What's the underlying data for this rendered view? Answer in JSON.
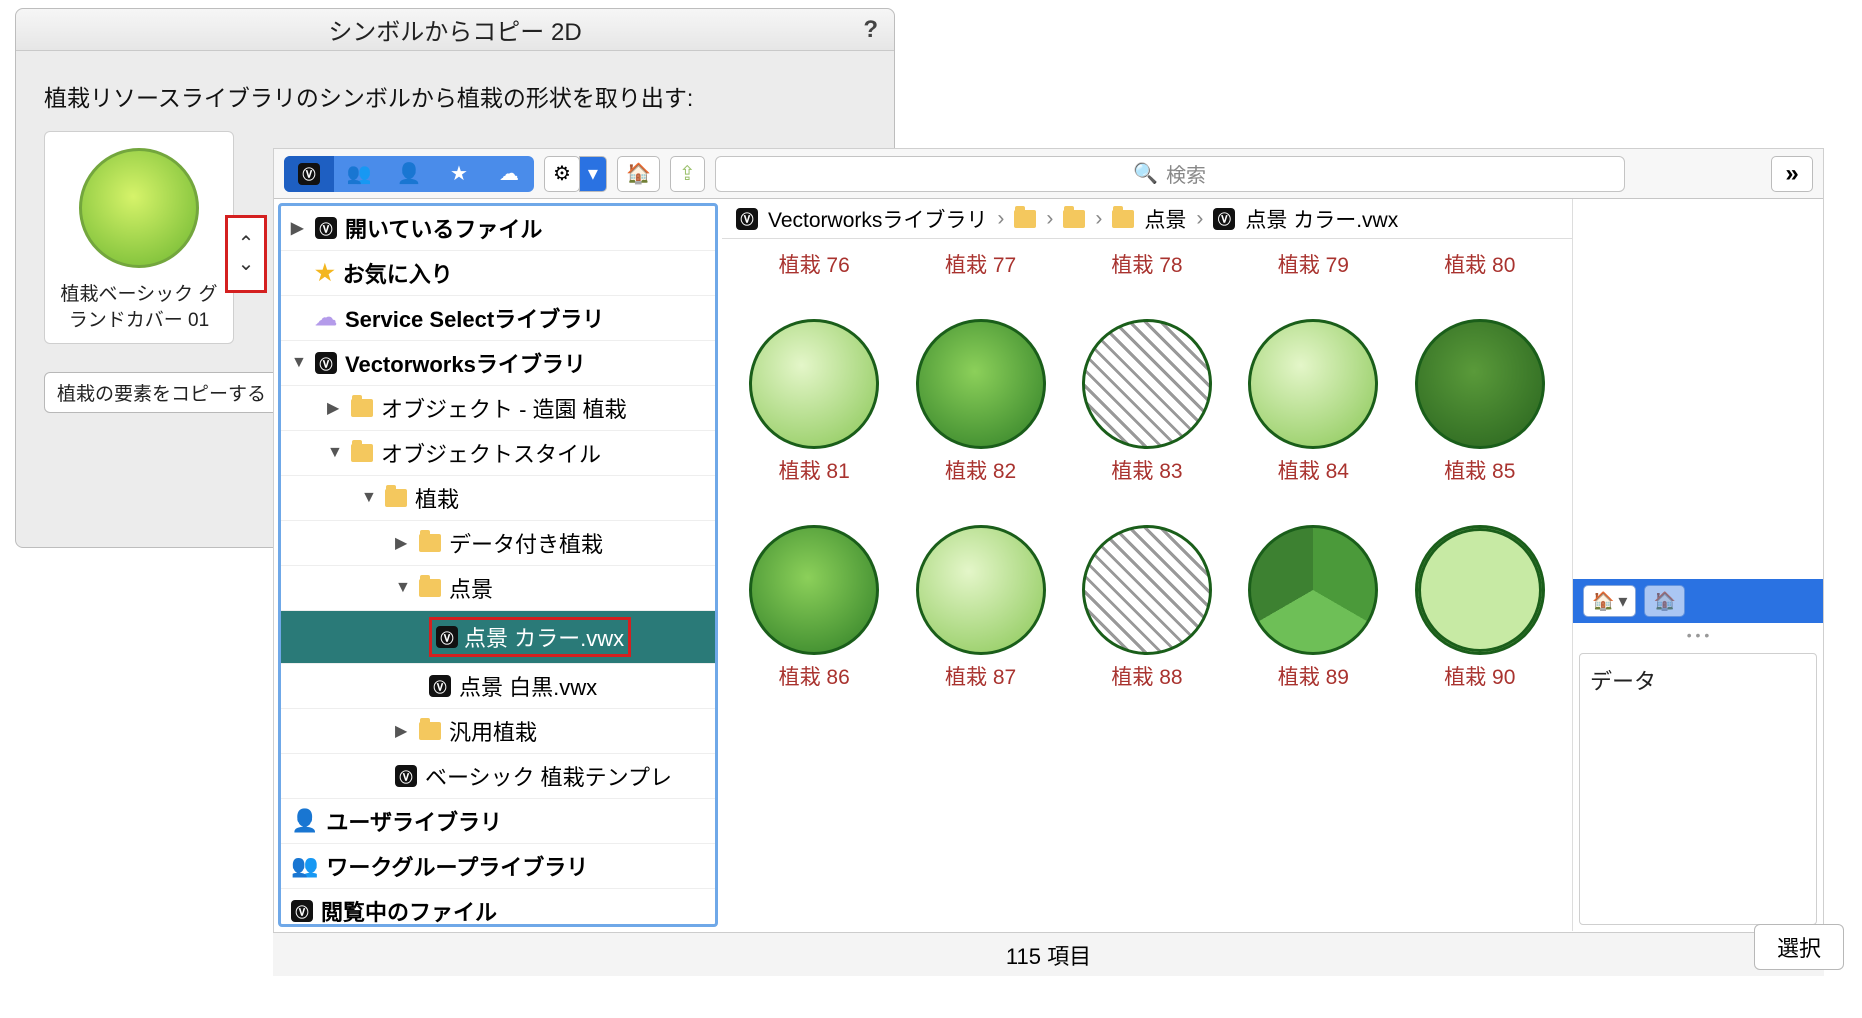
{
  "dialog": {
    "title": "シンボルからコピー 2D",
    "help": "?",
    "instruction": "植栽リソースライブラリのシンボルから植栽の形状を取り出す:",
    "preview_label": "植栽ベーシック グランドカバー 01",
    "copy_button": "植栽の要素をコピーする"
  },
  "toolbar": {
    "search_placeholder": "検索",
    "overflow": "»"
  },
  "tree": {
    "open_files": "開いているファイル",
    "favorites": "お気に入り",
    "service_select": "Service Selectライブラリ",
    "vw_lib": "Vectorworksライブラリ",
    "obj_landscape": "オブジェクト - 造園 植栽",
    "obj_styles": "オブジェクトスタイル",
    "plants": "植栽",
    "data_plants": "データ付き植栽",
    "scenery": "点景",
    "scenery_color": "点景 カラー.vwx",
    "scenery_bw": "点景 白黒.vwx",
    "general_plants": "汎用植栽",
    "basic_template": "ベーシック 植栽テンプレ",
    "user_lib": "ユーザライブラリ",
    "workgroup_lib": "ワークグループライブラリ",
    "browsing_file": "閲覧中のファイル"
  },
  "breadcrumb": {
    "root": "Vectorworksライブラリ",
    "scenery": "点景",
    "file": "点景 カラー.vwx"
  },
  "thumbs_row1": [
    "植栽 76",
    "植栽 77",
    "植栽 78",
    "植栽 79",
    "植栽 80"
  ],
  "thumbs_row2": [
    "植栽 81",
    "植栽 82",
    "植栽 83",
    "植栽 84",
    "植栽 85"
  ],
  "thumbs_row3": [
    "植栽 86",
    "植栽 87",
    "植栽 88",
    "植栽 89",
    "植栽 90"
  ],
  "right": {
    "data_label": "データ"
  },
  "footer": {
    "count": "115 項目",
    "select": "選択"
  }
}
